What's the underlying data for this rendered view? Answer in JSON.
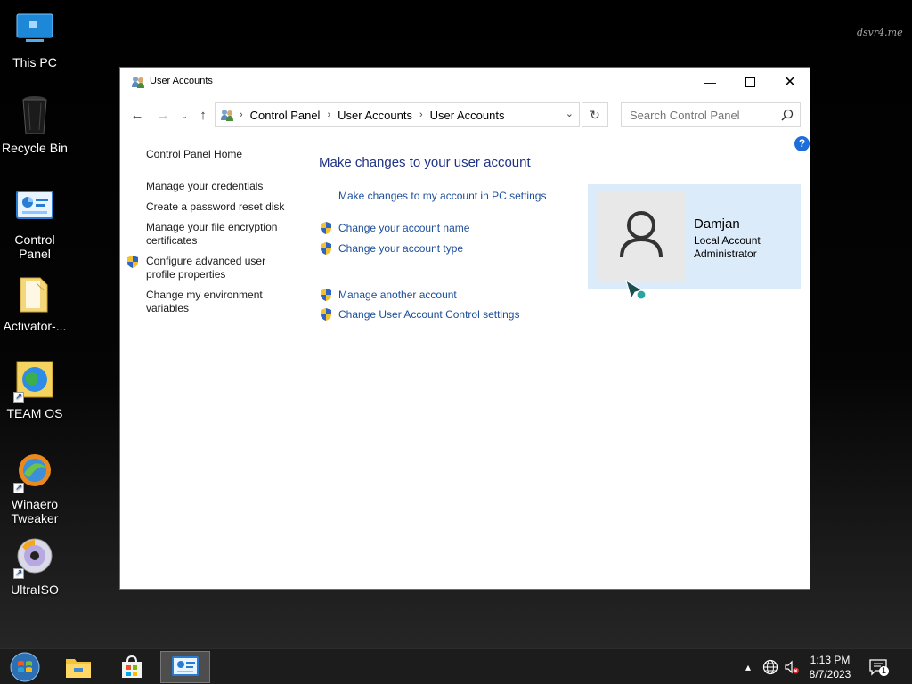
{
  "desktop": {
    "watermark": "dsvr4.me",
    "icons": [
      {
        "label": "This PC",
        "icon": "this-pc-icon"
      },
      {
        "label": "Recycle Bin",
        "icon": "recycle-bin-icon"
      },
      {
        "label": "Control Panel",
        "icon": "control-panel-icon"
      },
      {
        "label": "Activator-...",
        "icon": "folder-icon"
      },
      {
        "label": "TEAM OS",
        "icon": "team-os-icon"
      },
      {
        "label": "Winaero Tweaker",
        "icon": "winaero-tweaker-icon"
      },
      {
        "label": "UltraISO",
        "icon": "ultraiso-icon"
      }
    ]
  },
  "window": {
    "title": "User Accounts",
    "address": {
      "crumbs": [
        "Control Panel",
        "User Accounts",
        "User Accounts"
      ]
    },
    "search": {
      "placeholder": "Search Control Panel"
    },
    "help": "?",
    "sidebar": {
      "home": "Control Panel Home",
      "links": [
        "Manage your credentials",
        "Create a password reset disk",
        "Manage your file encryption certificates",
        "Configure advanced user profile properties",
        "Change my environment variables"
      ]
    },
    "main": {
      "title": "Make changes to your user account",
      "pc_settings_link": "Make changes to my account in PC settings",
      "tasks": [
        "Change your account name",
        "Change your account type",
        "Manage another account",
        "Change User Account Control settings"
      ]
    },
    "user": {
      "name": "Damjan",
      "type": "Local Account",
      "role": "Administrator"
    }
  },
  "taskbar": {
    "items": [
      "start-button",
      "file-explorer",
      "microsoft-store",
      "user-accounts-window"
    ],
    "clock": {
      "time": "1:13 PM",
      "date": "8/7/2023"
    },
    "notification_count": "1",
    "colors": {
      "taskbar": "#1c1c1c",
      "link": "#1c4e9a",
      "heading": "#1e3287",
      "user_card": "#dcebfa"
    }
  }
}
